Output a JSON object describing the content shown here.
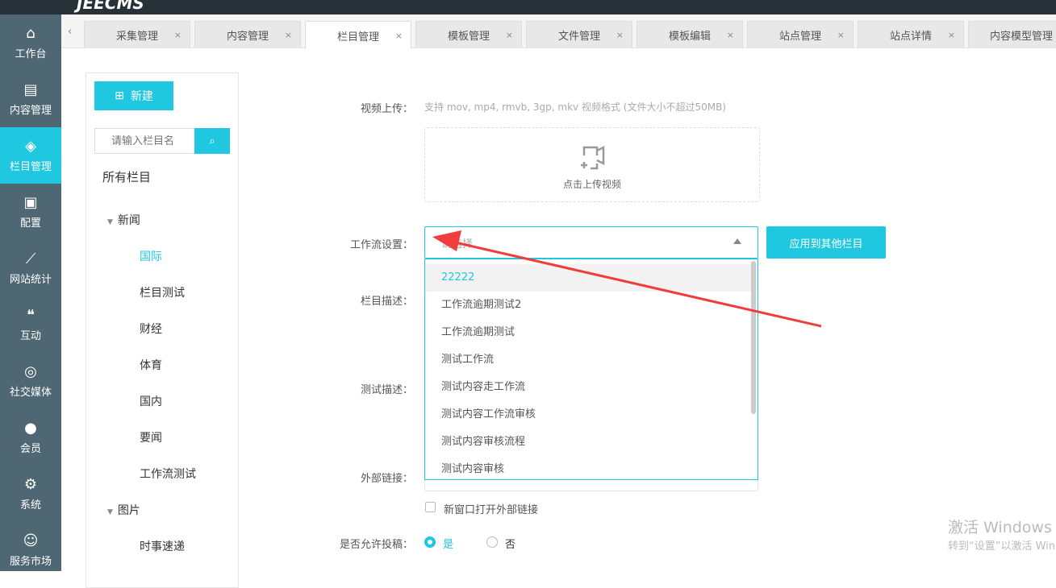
{
  "header": {
    "logo": "JEECMS"
  },
  "sidebar": {
    "items": [
      {
        "label": "工作台",
        "icon": "home-icon",
        "glyph": "⌂"
      },
      {
        "label": "内容管理",
        "icon": "document-icon",
        "glyph": "▤"
      },
      {
        "label": "栏目管理",
        "icon": "layers-icon",
        "glyph": "◈"
      },
      {
        "label": "配置",
        "icon": "box-icon",
        "glyph": "▣"
      },
      {
        "label": "网站统计",
        "icon": "chart-icon",
        "glyph": "⟋"
      },
      {
        "label": "互动",
        "icon": "chat-icon",
        "glyph": "❝"
      },
      {
        "label": "社交媒体",
        "icon": "target-icon",
        "glyph": "◎"
      },
      {
        "label": "会员",
        "icon": "user-icon",
        "glyph": "●"
      },
      {
        "label": "系统",
        "icon": "gear-icon",
        "glyph": "⚙"
      },
      {
        "label": "服务市场",
        "icon": "service-icon",
        "glyph": "☺"
      }
    ],
    "active": "栏目管理"
  },
  "tabs": [
    {
      "label": "采集管理"
    },
    {
      "label": "内容管理"
    },
    {
      "label": "栏目管理",
      "active": true
    },
    {
      "label": "模板管理"
    },
    {
      "label": "文件管理"
    },
    {
      "label": "模板编辑"
    },
    {
      "label": "站点管理"
    },
    {
      "label": "站点详情"
    },
    {
      "label": "内容模型管理"
    }
  ],
  "tree_panel": {
    "new_label": "新建",
    "search_placeholder": "请输入栏目名",
    "root": "所有栏目",
    "nodes": [
      {
        "label": "新闻",
        "group": true
      },
      {
        "label": "国际",
        "selected": true
      },
      {
        "label": "栏目测试"
      },
      {
        "label": "财经"
      },
      {
        "label": "体育"
      },
      {
        "label": "国内"
      },
      {
        "label": "要闻"
      },
      {
        "label": "工作流测试"
      },
      {
        "label": "图片",
        "group": true
      },
      {
        "label": "时事速递"
      }
    ]
  },
  "form": {
    "video_label": "视频上传：",
    "video_hint": "支持 mov, mp4, rmvb, 3gp, mkv 视频格式 (文件大小不超过50MB)",
    "upload_text": "点击上传视频",
    "workflow_label": "工作流设置：",
    "workflow_placeholder": "请选择",
    "apply_label": "应用到其他栏目",
    "desc_label": "栏目描述：",
    "test_desc_label": "测试描述：",
    "ext_link_label": "外部链接：",
    "new_window_label": "新窗口打开外部链接",
    "allow_label": "是否允许投稿：",
    "yes": "是",
    "no": "否",
    "options": [
      "22222",
      "工作流逾期测试2",
      "工作流逾期测试",
      "测试工作流",
      "测试内容走工作流",
      "测试内容工作流审核",
      "测试内容审核流程",
      "测试内容审核"
    ]
  },
  "watermark": {
    "line1": "激活 Windows",
    "line2": "转到“设置”以激活 Windows。"
  },
  "colors": {
    "accent": "#1fc8e0",
    "sidebar": "#4e6772",
    "annotation": "#f03c3c"
  }
}
